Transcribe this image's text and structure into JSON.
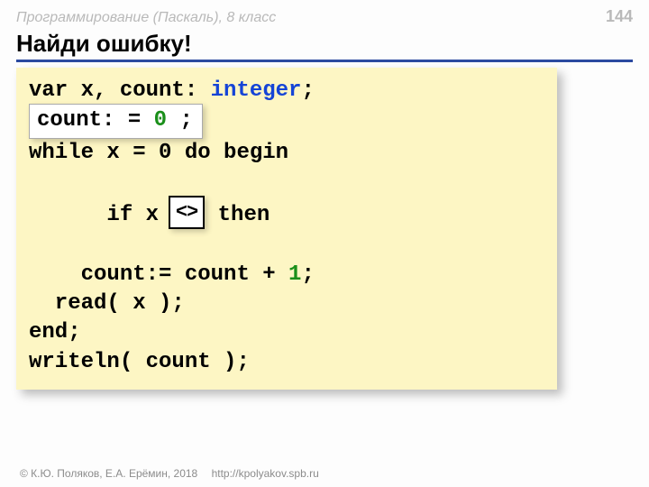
{
  "header": {
    "course": "Программирование (Паскаль), 8 класс",
    "page": "144"
  },
  "title": "Найди ошибку!",
  "code": {
    "line1_a": "var x, count: ",
    "line1_type": "integer",
    "line1_b": ";",
    "line2_count": "count:",
    "line2_eq": "=",
    "line2_zero": "0",
    "line2_semi": ";",
    "line3": "while x = 0 do begin",
    "line4_a": "  if x ",
    "line4_gt": ">",
    "line4_callout": "<>",
    "line4_b": " then",
    "line5_a": "    count:= count + ",
    "line5_num": "1",
    "line5_b": ";",
    "line6": "  read( x );",
    "line7": "end;",
    "line8": "writeln( count );"
  },
  "footer": {
    "copyright": "© К.Ю. Поляков, Е.А. Ерёмин, 2018",
    "link": "http://kpolyakov.spb.ru"
  }
}
